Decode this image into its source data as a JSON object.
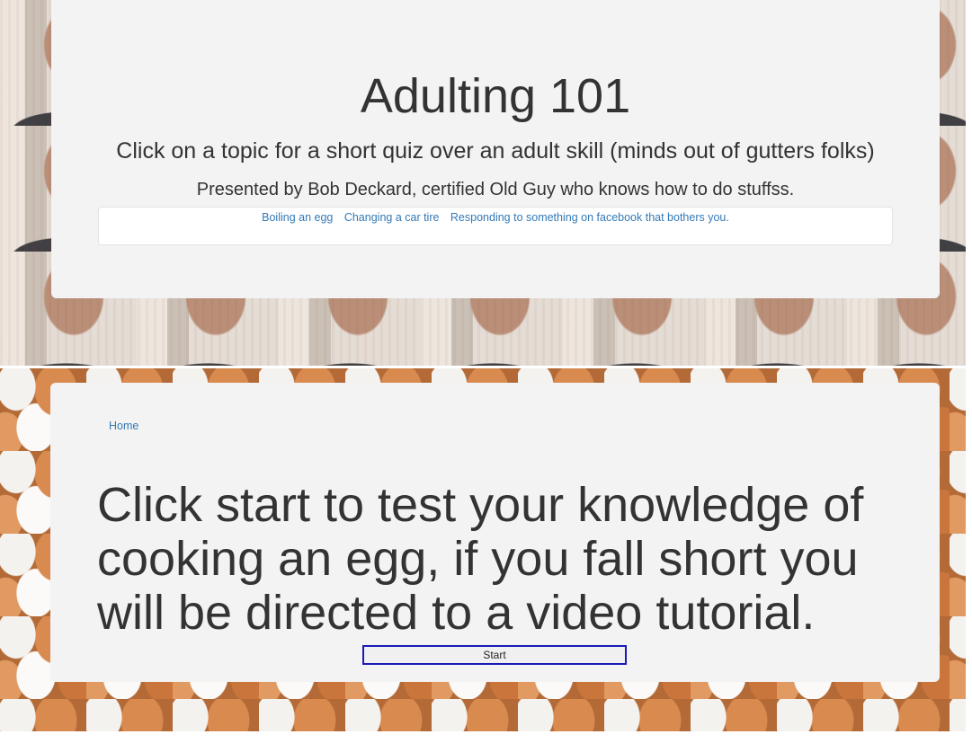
{
  "header": {
    "title": "Adulting 101",
    "subtitle": "Click on a topic for a short quiz over an adult skill (minds out of gutters folks)",
    "presenter": "Presented by Bob Deckard, certified Old Guy who knows how to do stuffss."
  },
  "topics": [
    {
      "label": "Boiling an egg"
    },
    {
      "label": "Changing a car tire"
    },
    {
      "label": "Responding to something on facebook that bothers you."
    }
  ],
  "quiz": {
    "home_label": "Home",
    "prompt": "Click start to test your knowledge of cooking an egg, if you fall short you will be directed to a video tutorial.",
    "start_label": "Start"
  },
  "colors": {
    "panel": "#f3f3f3",
    "link": "#337ab7",
    "text": "#333333",
    "start_border": "#1a1ab8"
  }
}
